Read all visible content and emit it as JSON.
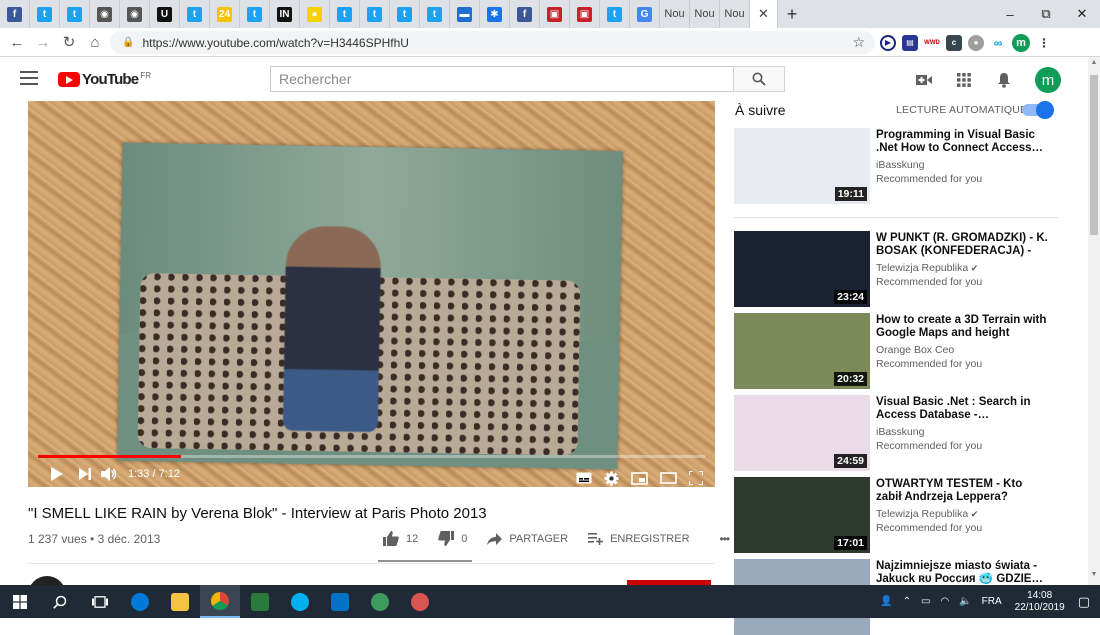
{
  "browser": {
    "tabs": [
      {
        "icon": "facebook-icon",
        "color": "#3b5998",
        "glyph": "f"
      },
      {
        "icon": "twitter-icon",
        "color": "#1da1f2",
        "glyph": "t"
      },
      {
        "icon": "twitter-icon",
        "color": "#1da1f2",
        "glyph": "t"
      },
      {
        "icon": "gray-circle-icon",
        "color": "#555555",
        "glyph": "◉"
      },
      {
        "icon": "gray-circle-icon",
        "color": "#555555",
        "glyph": "◉"
      },
      {
        "icon": "u-icon",
        "color": "#111111",
        "glyph": "U"
      },
      {
        "icon": "twitter-square-icon",
        "color": "#1da1f2",
        "glyph": "t"
      },
      {
        "icon": "yellow-24-icon",
        "color": "#f6c300",
        "glyph": "24"
      },
      {
        "icon": "twitter-icon",
        "color": "#1da1f2",
        "glyph": "t"
      },
      {
        "icon": "in-icon",
        "color": "#111111",
        "glyph": "IN"
      },
      {
        "icon": "yellow-dot-icon",
        "color": "#f7d000",
        "glyph": "●"
      },
      {
        "icon": "twitter-icon",
        "color": "#1da1f2",
        "glyph": "t"
      },
      {
        "icon": "twitter-icon",
        "color": "#1da1f2",
        "glyph": "t"
      },
      {
        "icon": "twitter-icon",
        "color": "#1da1f2",
        "glyph": "t"
      },
      {
        "icon": "twitter-icon",
        "color": "#1da1f2",
        "glyph": "t"
      },
      {
        "icon": "ukraine-flag-icon",
        "color": "#1f6fd1",
        "glyph": "▬"
      },
      {
        "icon": "gear-blue-icon",
        "color": "#1a73e8",
        "glyph": "✱"
      },
      {
        "icon": "facebook-icon",
        "color": "#3b5998",
        "glyph": "f"
      },
      {
        "icon": "red-news-icon",
        "color": "#c9202b",
        "glyph": "▣"
      },
      {
        "icon": "red-news-icon",
        "color": "#c9202b",
        "glyph": "▣"
      },
      {
        "icon": "twitter-icon",
        "color": "#1da1f2",
        "glyph": "t"
      },
      {
        "icon": "google-icon",
        "color": "#4285f4",
        "glyph": "G"
      }
    ],
    "text_tabs": [
      "Nou",
      "Nou",
      "Nou"
    ],
    "address": "https://www.youtube.com/watch?v=H3446SPHfhU",
    "new_tab": "+",
    "win_min": "–",
    "win_max": "⧉",
    "win_close": "✕"
  },
  "youtube": {
    "logo_text": "YouTube",
    "logo_region": "FR",
    "search_placeholder": "Rechercher",
    "avatar_letter": "m"
  },
  "player": {
    "time": "1:33 / 7:12",
    "progress_fraction": 0.215
  },
  "video": {
    "title": "\"I SMELL LIKE RAIN by Verena Blok\" - Interview at Paris Photo 2013",
    "meta": "1 237 vues • 3 déc. 2013",
    "likes": "12",
    "dislikes": "0",
    "share_label": "PARTAGER",
    "save_label": "ENREGISTRER",
    "more": "•••"
  },
  "sidebar": {
    "up_next": "À suivre",
    "autoplay": "LECTURE AUTOMATIQUE",
    "items": [
      {
        "title": "Programming in Visual Basic .Net How to Connect Access…",
        "channel": "iBasskung",
        "rec": "Recommended for you",
        "duration": "19:11",
        "thumb": "#e8ecf2",
        "verified": false
      },
      {
        "title": "W PUNKT (R. GROMADZKI) - K. BOSAK (KONFEDERACJA) - JA…",
        "channel": "Telewizja Republika",
        "rec": "Recommended for you",
        "duration": "23:24",
        "thumb": "#1b2333",
        "verified": true
      },
      {
        "title": "How to create a 3D Terrain with Google Maps and height maps…",
        "channel": "Orange Box Ceo",
        "rec": "Recommended for you",
        "duration": "20:32",
        "thumb": "#7c8a5a",
        "verified": false
      },
      {
        "title": "Visual Basic .Net : Search in Access Database -…",
        "channel": "iBasskung",
        "rec": "Recommended for you",
        "duration": "24:59",
        "thumb": "#e9dbe8",
        "verified": false
      },
      {
        "title": "OTWARTYM TESTEM - Kto zabił Andrzeja Leppera? Rozmowa z…",
        "channel": "Telewizja Republika",
        "rec": "Recommended for you",
        "duration": "17:01",
        "thumb": "#2e3a2e",
        "verified": true
      },
      {
        "title": "Najzimniejsze miasto świata - Jakuck ʀᴜ Россия 🥶 GDZIE…",
        "channel": "",
        "rec": "",
        "duration": "",
        "thumb": "#9aaabd",
        "verified": false
      }
    ]
  },
  "taskbar": {
    "lang": "FRA",
    "time": "14:08",
    "date": "22/10/2019"
  }
}
